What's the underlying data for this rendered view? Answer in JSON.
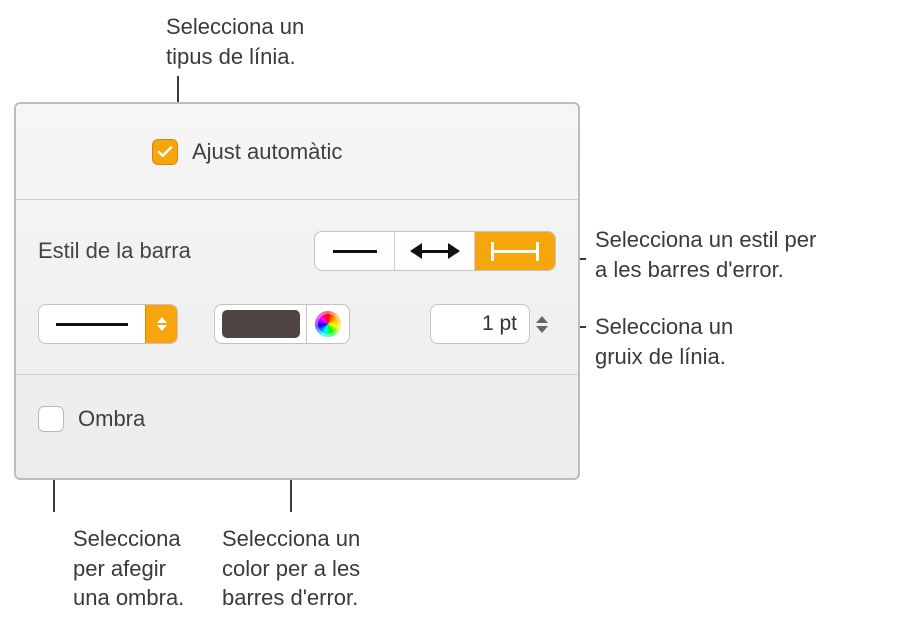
{
  "callouts": {
    "line_type": "Selecciona un\ntipus de línia.",
    "bar_style": "Selecciona un estil per\na les barres d'error.",
    "line_weight": "Selecciona un\ngruix de línia.",
    "shadow": "Selecciona\nper afegir\nuna ombra.",
    "color": "Selecciona un\ncolor per a les\nbarres d'error."
  },
  "panel": {
    "autofit_label": "Ajust automàtic",
    "autofit_checked": true,
    "bar_style_title": "Estil de la barra",
    "bar_style_options": [
      "plain",
      "arrow",
      "tee"
    ],
    "bar_style_selected": "tee",
    "line_type_selected": "solid",
    "line_color_hex": "#4f4644",
    "line_weight_value": "1 pt",
    "shadow_label": "Ombra",
    "shadow_checked": false
  }
}
